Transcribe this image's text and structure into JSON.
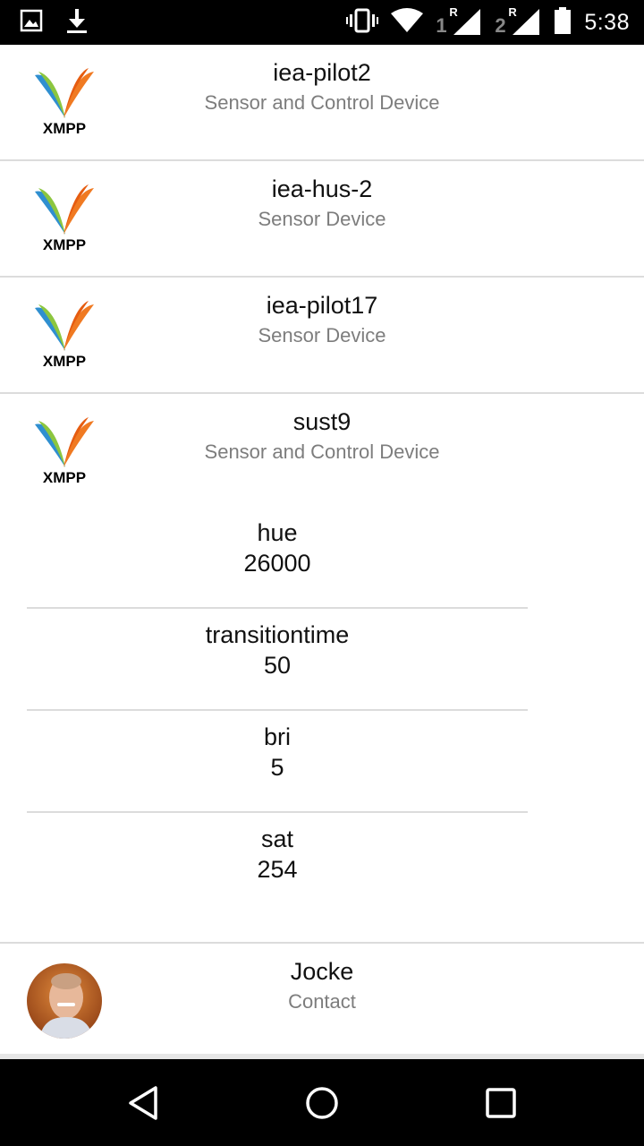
{
  "status_bar": {
    "time": "5:38",
    "icons": [
      "image-icon",
      "download-icon",
      "vibrate-icon",
      "wifi-icon",
      "signal-sim1-icon",
      "signal-sim2-icon",
      "battery-icon"
    ],
    "sim1_label": "1",
    "sim1_roaming": "R",
    "sim2_label": "2",
    "sim2_roaming": "R"
  },
  "devices": [
    {
      "title": "iea-pilot2",
      "subtitle": "Sensor and Control Device",
      "icon": "xmpp-logo-icon"
    },
    {
      "title": "iea-hus-2",
      "subtitle": "Sensor Device",
      "icon": "xmpp-logo-icon"
    },
    {
      "title": "iea-pilot17",
      "subtitle": "Sensor Device",
      "icon": "xmpp-logo-icon"
    },
    {
      "title": "sust9",
      "subtitle": "Sensor and Control Device",
      "icon": "xmpp-logo-icon",
      "properties": [
        {
          "key": "hue",
          "value": "26000"
        },
        {
          "key": "transitiontime",
          "value": "50"
        },
        {
          "key": "bri",
          "value": "5"
        },
        {
          "key": "sat",
          "value": "254"
        }
      ]
    }
  ],
  "contact": {
    "title": "Jocke",
    "subtitle": "Contact",
    "icon": "avatar"
  },
  "logo_text": "XMPP",
  "navigation": [
    "back-icon",
    "home-icon",
    "recents-icon"
  ]
}
